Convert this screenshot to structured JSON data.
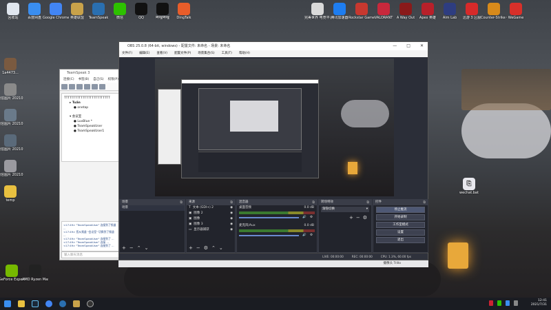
{
  "desktop": {
    "top_icons": [
      {
        "label": "回收站",
        "color": "#e0e6ee"
      },
      {
        "label": "百度网盘",
        "color": "#3a8ef0"
      },
      {
        "label": "Google Chrome",
        "color": "#4285f4"
      },
      {
        "label": "英雄联盟",
        "color": "#c8a24a"
      },
      {
        "label": "TeamSpeak",
        "color": "#2a6fb0"
      },
      {
        "label": "微信",
        "color": "#2dc100"
      },
      {
        "label": "QQ",
        "color": "#111"
      },
      {
        "label": "哔哩哔哩",
        "color": "#111"
      },
      {
        "label": "DingTalk",
        "color": "#e85d2a"
      }
    ],
    "top_right_icons": [
      {
        "label": "完美世界 电竞平台",
        "color": "#d9d9d9"
      },
      {
        "label": "腾讯加速器",
        "color": "#1e7df0"
      },
      {
        "label": "Rockstar Games Launcher",
        "color": "#c7382f"
      },
      {
        "label": "VALORANT",
        "color": "#c8283c"
      },
      {
        "label": "A Way Out",
        "color": "#8a1a1a"
      },
      {
        "label": "Apex 英雄",
        "color": "#b8202a"
      },
      {
        "label": "Aim Lab",
        "color": "#2e3d80"
      },
      {
        "label": "迅游 3 区服",
        "color": "#d62a2a"
      },
      {
        "label": "Counter-Strike Global Offensive",
        "color": "#d88a1a"
      },
      {
        "label": "WeGame",
        "color": "#d8302a"
      }
    ],
    "left_icons": [
      {
        "label": "1a4473...",
        "color": "#7a5a40"
      },
      {
        "label": "微信图片 2021072...",
        "color": "#8a8a8a"
      },
      {
        "label": "微信图片 2021072...",
        "color": "#6a7a8a"
      },
      {
        "label": "微信图片 2021072...",
        "color": "#5a6a7a"
      },
      {
        "label": "微信图片 2021072...",
        "color": "#9a9aa0"
      },
      {
        "label": "temp",
        "color": "#e8c040"
      }
    ],
    "bottom_left_icons": [
      {
        "label": "GeForce Experience",
        "color": "#76b900"
      },
      {
        "label": "AMD Ryzen Master",
        "color": "#222"
      }
    ],
    "right_file": {
      "label": "wechat.bat",
      "color": "#e8e8ee"
    }
  },
  "teamspeak": {
    "title": "TeamSpeak 3",
    "menu": [
      "连接(C)",
      "书签(B)",
      "自己(S)",
      "权限(P)"
    ],
    "tree": {
      "server": "TTTTTTTTTTTTTTTTTTTTTTTTT",
      "channel1": "Tuấn",
      "user1": "onetap",
      "channel2": "会议室",
      "users": [
        "LuvBlue *",
        "TeamSpeakUser",
        "TeamSpeakUser1"
      ]
    },
    "chat_lines": [
      "<17:49> \"TeamSpeakUser\" 连接到了频道 ...",
      "<17:49> 您从频道 \"会议室\" 切换到了频道 ...",
      "<17:49> \"TeamSpeakUser\" 连接到了 ...",
      "<17:49> \"TeamSpeakUser\" 连接 ...",
      "<17:49> \"TeamSpeakUser\" 连接到了 ..."
    ],
    "chat_placeholder": "输入聊天消息"
  },
  "obs": {
    "title": "OBS 25.0.8 (64-bit, windows) - 配置文件: 未命名 - 场景: 未命名",
    "menu": [
      "文件(F)",
      "编辑(E)",
      "查看(V)",
      "配置文件(P)",
      "场景集合(S)",
      "工具(T)",
      "帮助(H)"
    ],
    "scenes": {
      "header": "场景",
      "items": [
        "场景"
      ]
    },
    "sources": {
      "header": "来源",
      "items": [
        {
          "label": "文本 (GDI+) 2",
          "icon": "text-icon"
        },
        {
          "label": "图像 2",
          "icon": "image-icon"
        },
        {
          "label": "图像",
          "icon": "image-icon"
        },
        {
          "label": "图像 3",
          "icon": "image-icon"
        },
        {
          "label": "显示器捕获",
          "icon": "monitor-icon"
        }
      ]
    },
    "mixer": {
      "header": "混音器",
      "channels": [
        {
          "name": "桌面音频",
          "db": "0.0 dB"
        },
        {
          "name": "麦克风/Aux",
          "db": "0.0 dB"
        }
      ]
    },
    "transitions": {
      "header": "转场特效",
      "selected": "渐隐切换"
    },
    "controls": {
      "header": "控件",
      "buttons": [
        "停止推流",
        "开始录制",
        "工作室模式",
        "设置",
        "退出"
      ]
    },
    "status": {
      "live": "LIVE: 00:00:00",
      "rec": "REC: 00:00:00",
      "cpu": "CPU: 1.3%, 60.00 fps"
    },
    "footer_text": "摄像头 Trillo",
    "window_controls": [
      "—",
      "□",
      "✕"
    ]
  },
  "taskbar": {
    "time": "12:41",
    "date": "2021/7/31"
  }
}
